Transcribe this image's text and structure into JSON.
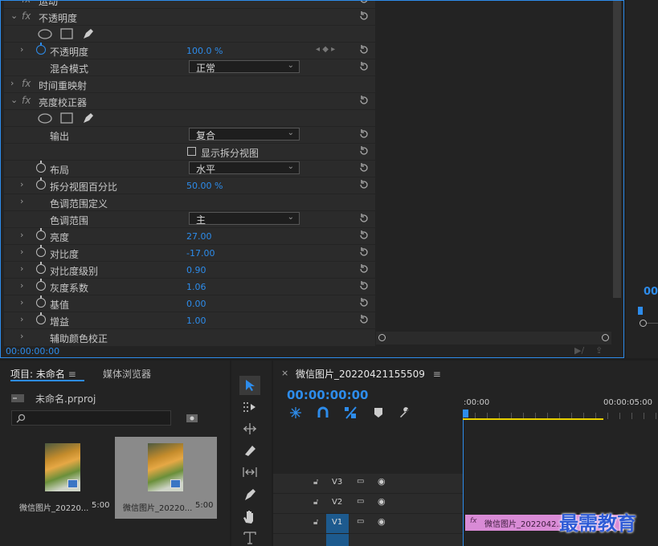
{
  "effect_controls": {
    "rows": [
      {
        "label": "运动",
        "type": "fx-header"
      },
      {
        "label": "不透明度",
        "type": "fx-header"
      },
      {
        "type": "masks"
      },
      {
        "label": "不透明度",
        "value": "100.0 %",
        "type": "param"
      },
      {
        "label": "混合模式",
        "value": "正常",
        "type": "dropdown"
      },
      {
        "label": "时间重映射",
        "type": "fx-header"
      },
      {
        "label": "亮度校正器",
        "type": "fx-header"
      },
      {
        "type": "masks"
      },
      {
        "label": "输出",
        "value": "复合",
        "type": "dropdown"
      },
      {
        "label": "显示拆分视图",
        "type": "checkbox"
      },
      {
        "label": "布局",
        "value": "水平",
        "type": "dropdown"
      },
      {
        "label": "拆分视图百分比",
        "value": "50.00 %",
        "type": "param"
      },
      {
        "label": "色调范围定义",
        "type": "group"
      },
      {
        "label": "色调范围",
        "value": "主",
        "type": "dropdown"
      },
      {
        "label": "亮度",
        "value": "27.00",
        "type": "param"
      },
      {
        "label": "对比度",
        "value": "-17.00",
        "type": "param"
      },
      {
        "label": "对比度级别",
        "value": "0.90",
        "type": "param"
      },
      {
        "label": "灰度系数",
        "value": "1.06",
        "type": "param"
      },
      {
        "label": "基值",
        "value": "0.00",
        "type": "param"
      },
      {
        "label": "增益",
        "value": "1.00",
        "type": "param"
      },
      {
        "label": "辅助颜色校正",
        "type": "group"
      }
    ],
    "timecode": "00:00:00:00"
  },
  "program_monitor": {
    "timecode_fragment": "00"
  },
  "project": {
    "tab_project": "项目: 未命名",
    "tab_media_browser": "媒体浏览器",
    "project_file": "未命名.prproj",
    "search_placeholder": "",
    "items": [
      {
        "name": "微信图片_20220...",
        "duration": "5:00"
      },
      {
        "name": "微信图片_20220...",
        "duration": "5:00"
      }
    ]
  },
  "timeline": {
    "tab_label": "微信图片_20220421155509",
    "timecode": "00:00:00:00",
    "ruler": [
      ":00:00",
      "00:00:05:00"
    ],
    "tracks": [
      "V3",
      "V2",
      "V1"
    ],
    "clip_label": "微信图片_2022042...",
    "watermark": "最需教育"
  },
  "colors": {
    "accent": "#2d8ceb",
    "clip": "#d98bd6",
    "panel": "#232323"
  }
}
